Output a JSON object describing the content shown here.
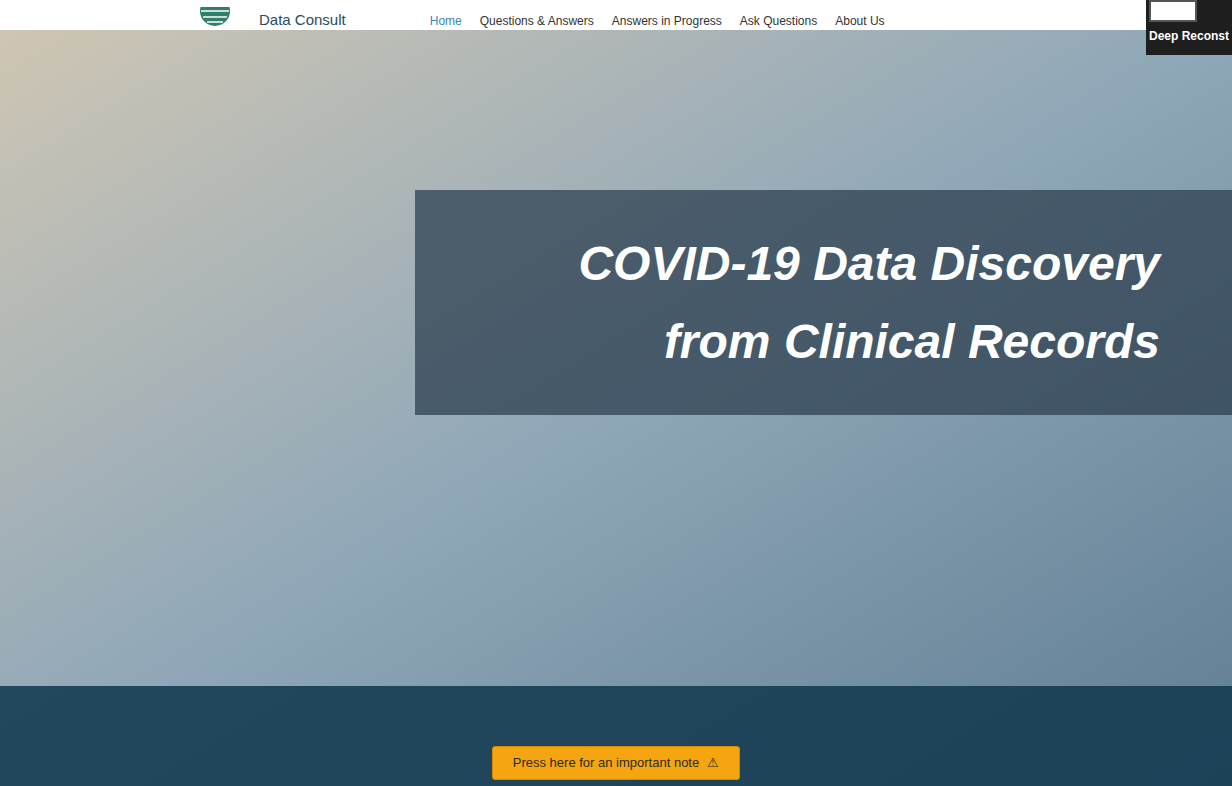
{
  "header": {
    "logo_text": "Data Consult",
    "nav": [
      {
        "label": "Home",
        "selected": true
      },
      {
        "label": "Questions & Answers",
        "selected": false
      },
      {
        "label": "Answers in Progress",
        "selected": false
      },
      {
        "label": "Ask Questions",
        "selected": false
      },
      {
        "label": "About Us",
        "selected": false
      }
    ]
  },
  "overlay": {
    "label": "Deep Reconst"
  },
  "hero": {
    "title_lines": [
      "COVID-19 Data Discovery",
      "from Clinical Records"
    ]
  },
  "notice_button": {
    "label": "Press here for an important note",
    "icon": "⚠"
  }
}
